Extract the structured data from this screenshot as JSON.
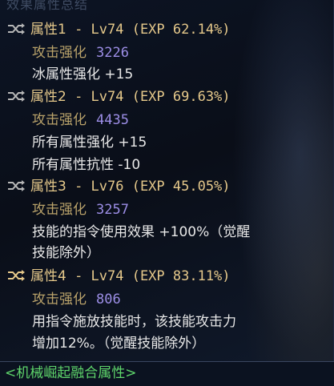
{
  "top_cut_text": "效果属性总结",
  "colors": {
    "header": "#e6c98b",
    "stat_name": "#b9a26a",
    "stat_value": "#9c8ee6",
    "effect": "#e8e8e8",
    "footer": "#5fd66b"
  },
  "attributes": [
    {
      "title": "属性1",
      "level_exp": " - Lv74 (EXP 62.14%)",
      "icon": "shuffle-icon",
      "stat_name": "攻击强化",
      "stat_value": "3226",
      "effects": [
        "冰属性强化 +15"
      ]
    },
    {
      "title": "属性2",
      "level_exp": " - Lv74 (EXP 69.63%)",
      "icon": "shuffle-icon",
      "stat_name": "攻击强化",
      "stat_value": "4435",
      "effects": [
        "所有属性强化 +15",
        "所有属性抗性 -10"
      ]
    },
    {
      "title": "属性3",
      "level_exp": " - Lv76 (EXP 45.05%)",
      "icon": "shuffle-icon",
      "stat_name": "攻击强化",
      "stat_value": "3257",
      "effects": [
        "技能的指令使用效果 +100%（觉醒",
        "技能除外）"
      ]
    },
    {
      "title": "属性4",
      "level_exp": " - Lv74 (EXP 83.11%)",
      "icon": "shuffle-icon",
      "stat_name": "攻击强化",
      "stat_value": "806",
      "effects": [
        "用指令施放技能时，该技能攻击力",
        "增加12%。（觉醒技能除外）"
      ]
    }
  ],
  "footer_text": "<机械崛起融合属性>"
}
